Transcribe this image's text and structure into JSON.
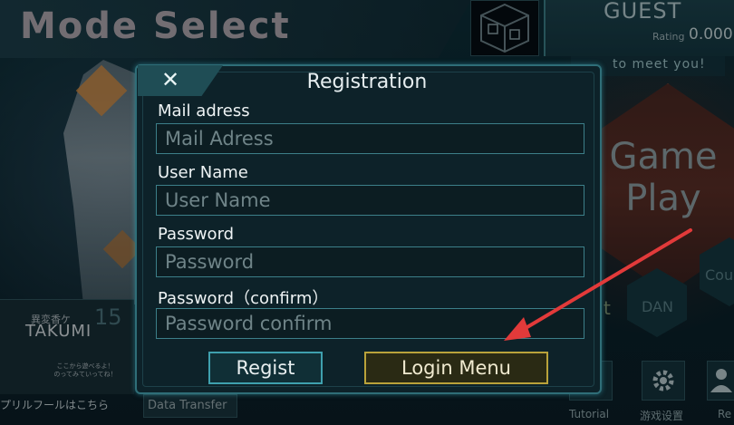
{
  "header": {
    "mode_title": "Mode Select",
    "player_name": "GUEST",
    "rating_label": "Rating",
    "rating_value": "0.000",
    "greeting": "to meet you!"
  },
  "menu": {
    "game_play": "Game Play",
    "dan_label": "DAN",
    "cou_label": "Cou",
    "t_label": "t"
  },
  "bottom_icons": [
    {
      "label": "Tutorial"
    },
    {
      "label": "游戏设置"
    },
    {
      "label": "Re"
    }
  ],
  "song": {
    "subtitle": "異変香ケ",
    "number": "15",
    "title": "TAKUMI",
    "note": "ここから遊べるよ！ のってみていってね！"
  },
  "footer": {
    "april": "プリルフールはこちら",
    "data_transfer": "Data Transfer"
  },
  "dialog": {
    "title": "Registration",
    "close_glyph": "✕",
    "fields": [
      {
        "label": "Mail adress",
        "placeholder": "Mail Adress"
      },
      {
        "label": "User Name",
        "placeholder": "User Name"
      },
      {
        "label": "Password",
        "placeholder": "Password"
      },
      {
        "label": "Password（confirm）",
        "placeholder": "Password confirm"
      }
    ],
    "regist_label": "Regist",
    "login_label": "Login Menu"
  },
  "colors": {
    "accent": "#3fa0ae",
    "login_border": "#b9a23a",
    "annotation_arrow": "#e23a3a"
  }
}
